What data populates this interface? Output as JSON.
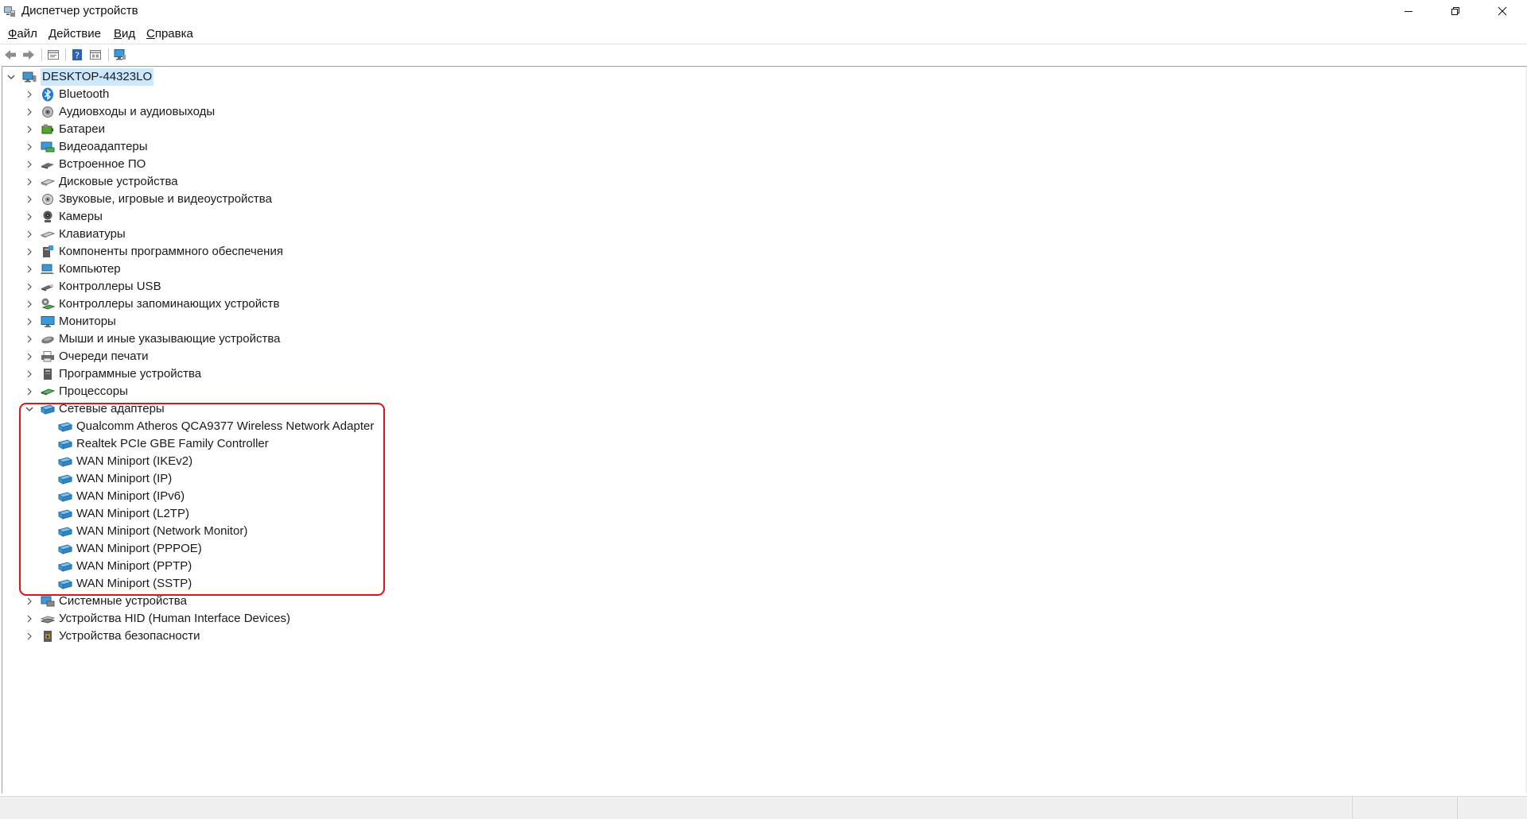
{
  "window": {
    "title": "Диспетчер устройств",
    "controls": [
      "minimize",
      "restore",
      "close"
    ]
  },
  "menu": {
    "items": [
      {
        "label": "Файл",
        "accel": "Ф",
        "rest": "айл"
      },
      {
        "label": "Действие",
        "accel": "Д",
        "rest": "ействие"
      },
      {
        "label": "Вид",
        "accel": "В",
        "rest": "ид"
      },
      {
        "label": "Справка",
        "accel": "С",
        "rest": "правка"
      }
    ]
  },
  "toolbar": {
    "icons": [
      "back-arrow-icon",
      "forward-arrow-icon",
      "properties-icon",
      "help-icon",
      "view-icon",
      "monitor-scan-icon"
    ]
  },
  "tree": {
    "root": {
      "label": "DESKTOP-44323LO",
      "expanded": true,
      "selected": true
    },
    "categories": [
      {
        "label": "Bluetooth",
        "icon": "bluetooth-icon",
        "expanded": false
      },
      {
        "label": "Аудиовходы и аудиовыходы",
        "icon": "audio-icon",
        "expanded": false
      },
      {
        "label": "Батареи",
        "icon": "battery-icon",
        "expanded": false
      },
      {
        "label": "Видеоадаптеры",
        "icon": "display-adapter-icon",
        "expanded": false
      },
      {
        "label": "Встроенное ПО",
        "icon": "firmware-icon",
        "expanded": false
      },
      {
        "label": "Дисковые устройства",
        "icon": "disk-icon",
        "expanded": false
      },
      {
        "label": "Звуковые, игровые и видеоустройства",
        "icon": "sound-icon",
        "expanded": false
      },
      {
        "label": "Камеры",
        "icon": "camera-icon",
        "expanded": false
      },
      {
        "label": "Клавиатуры",
        "icon": "keyboard-icon",
        "expanded": false
      },
      {
        "label": "Компоненты программного обеспечения",
        "icon": "software-component-icon",
        "expanded": false
      },
      {
        "label": "Компьютер",
        "icon": "computer-icon",
        "expanded": false
      },
      {
        "label": "Контроллеры USB",
        "icon": "usb-icon",
        "expanded": false
      },
      {
        "label": "Контроллеры запоминающих устройств",
        "icon": "storage-controller-icon",
        "expanded": false
      },
      {
        "label": "Мониторы",
        "icon": "monitor-icon",
        "expanded": false
      },
      {
        "label": "Мыши и иные указывающие устройства",
        "icon": "mouse-icon",
        "expanded": false
      },
      {
        "label": "Очереди печати",
        "icon": "printer-icon",
        "expanded": false
      },
      {
        "label": "Программные устройства",
        "icon": "software-device-icon",
        "expanded": false
      },
      {
        "label": "Процессоры",
        "icon": "processor-icon",
        "expanded": false
      },
      {
        "label": "Сетевые адаптеры",
        "icon": "network-adapter-icon",
        "expanded": true,
        "children": [
          "Qualcomm Atheros QCA9377 Wireless Network Adapter",
          "Realtek PCIe GBE Family Controller",
          "WAN Miniport (IKEv2)",
          "WAN Miniport (IP)",
          "WAN Miniport (IPv6)",
          "WAN Miniport (L2TP)",
          "WAN Miniport (Network Monitor)",
          "WAN Miniport (PPPOE)",
          "WAN Miniport (PPTP)",
          "WAN Miniport (SSTP)"
        ]
      },
      {
        "label": "Системные устройства",
        "icon": "system-device-icon",
        "expanded": false
      },
      {
        "label": "Устройства HID (Human Interface Devices)",
        "icon": "hid-icon",
        "expanded": false
      },
      {
        "label": "Устройства безопасности",
        "icon": "security-device-icon",
        "expanded": false
      }
    ]
  },
  "colors": {
    "selection": "#cce8ff",
    "highlight_border": "#e3101e",
    "network_icon": "#3a9ad9"
  }
}
